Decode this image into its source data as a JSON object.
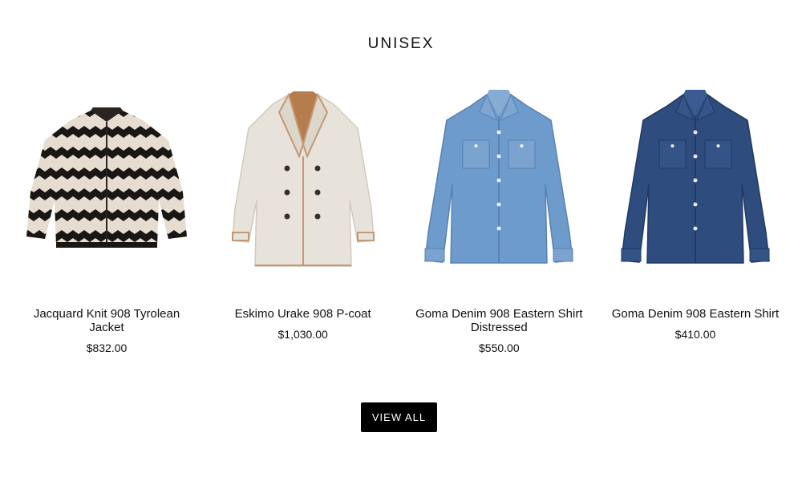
{
  "section": {
    "title": "UNISEX"
  },
  "products": [
    {
      "name": "Jacquard Knit 908 Tyrolean Jacket",
      "price": "$832.00",
      "image": "zigzag-jacket-image"
    },
    {
      "name": "Eskimo Urake 908 P-coat",
      "price": "$1,030.00",
      "image": "cream-peacoat-image"
    },
    {
      "name": "Goma Denim 908 Eastern Shirt Distressed",
      "price": "$550.00",
      "image": "light-denim-shirt-image"
    },
    {
      "name": "Goma Denim 908 Eastern Shirt",
      "price": "$410.00",
      "image": "dark-denim-shirt-image"
    }
  ],
  "actions": {
    "view_all_label": "VIEW ALL"
  },
  "colors": {
    "button_bg": "#000000",
    "button_text": "#ffffff",
    "text": "#111111",
    "light_denim": "#6d9bcc",
    "dark_denim": "#2e4c7e",
    "cream_coat": "#e8e3da",
    "coat_trim": "#c39873"
  }
}
